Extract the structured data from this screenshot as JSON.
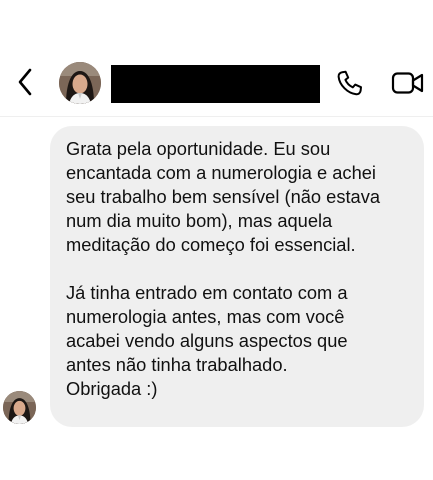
{
  "header": {
    "back_icon": "chevron-left-icon",
    "contact_avatar_icon": "profile-photo-avatar",
    "contact_name": "",
    "call_icon": "phone-icon",
    "video_icon": "video-camera-icon"
  },
  "message": {
    "paragraph_1": "Grata pela oportunidade. Eu sou\nencantada com a numerologia e achei\nseu trabalho bem sensível (não estava\nnum dia muito bom), mas aquela\nmeditação do começo foi essencial.",
    "paragraph_2": "Já tinha entrado em contato com a\nnumerologia antes, mas com você\nacabei vendo alguns aspectos que\nantes não tinha trabalhado.\nObrigada :)",
    "bubble_color": "#efefef"
  },
  "colors": {
    "background": "#ffffff",
    "icon": "#000000",
    "redaction": "#000000"
  }
}
